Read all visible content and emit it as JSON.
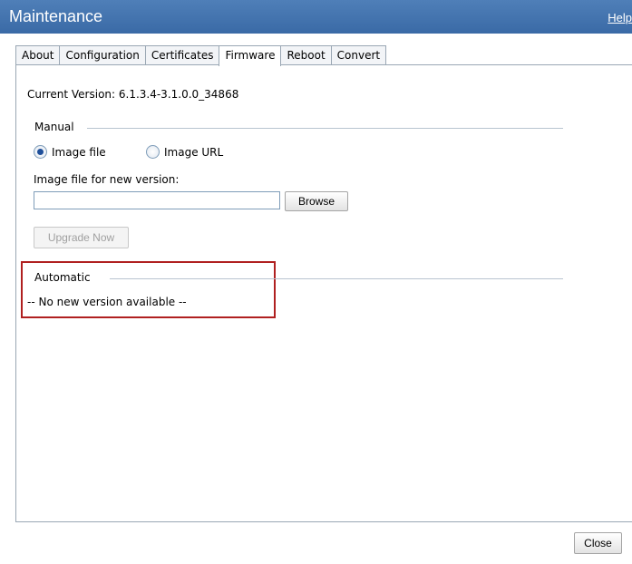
{
  "window": {
    "title": "Maintenance",
    "help_label": "Help"
  },
  "tabs": [
    {
      "label": "About"
    },
    {
      "label": "Configuration"
    },
    {
      "label": "Certificates"
    },
    {
      "label": "Firmware",
      "active": true
    },
    {
      "label": "Reboot"
    },
    {
      "label": "Convert"
    }
  ],
  "firmware": {
    "current_version": "Current Version: 6.1.3.4-3.1.0.0_34868",
    "manual_legend": "Manual",
    "radio_image_file": "Image file",
    "radio_image_url": "Image URL",
    "image_file_label": "Image file for new version:",
    "image_file_value": "",
    "browse_label": "Browse",
    "upgrade_label": "Upgrade Now",
    "automatic_legend": "Automatic",
    "no_new_version": "-- No new version available --"
  },
  "footer": {
    "close_label": "Close"
  },
  "colors": {
    "titlebar": "#3f70ad",
    "highlight": "#b02020",
    "border": "#9aa7b4"
  }
}
